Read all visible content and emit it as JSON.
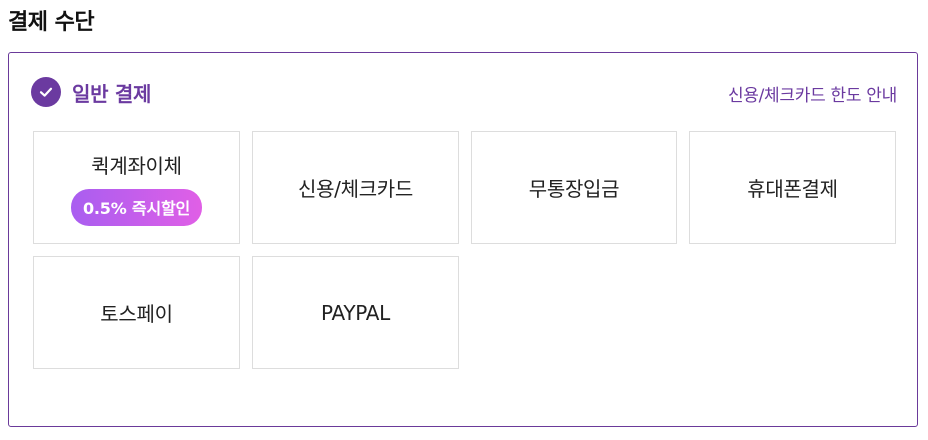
{
  "section": {
    "title": "결제 수단"
  },
  "general_payment": {
    "label": "일반 결제",
    "icon": "check-circle-icon",
    "selected": true,
    "limit_link": "신용/체크카드 한도 안내"
  },
  "options": [
    {
      "label": "퀵계좌이체",
      "badge": "0.5% 즉시할인"
    },
    {
      "label": "신용/체크카드"
    },
    {
      "label": "무통장입금"
    },
    {
      "label": "휴대폰결제"
    },
    {
      "label": "토스페이"
    },
    {
      "label": "PAYPAL"
    }
  ],
  "colors": {
    "accent": "#6b3aa0",
    "badge_gradient_start": "#a95ef0",
    "badge_gradient_end": "#e05fe6",
    "option_border": "#dddddd"
  }
}
